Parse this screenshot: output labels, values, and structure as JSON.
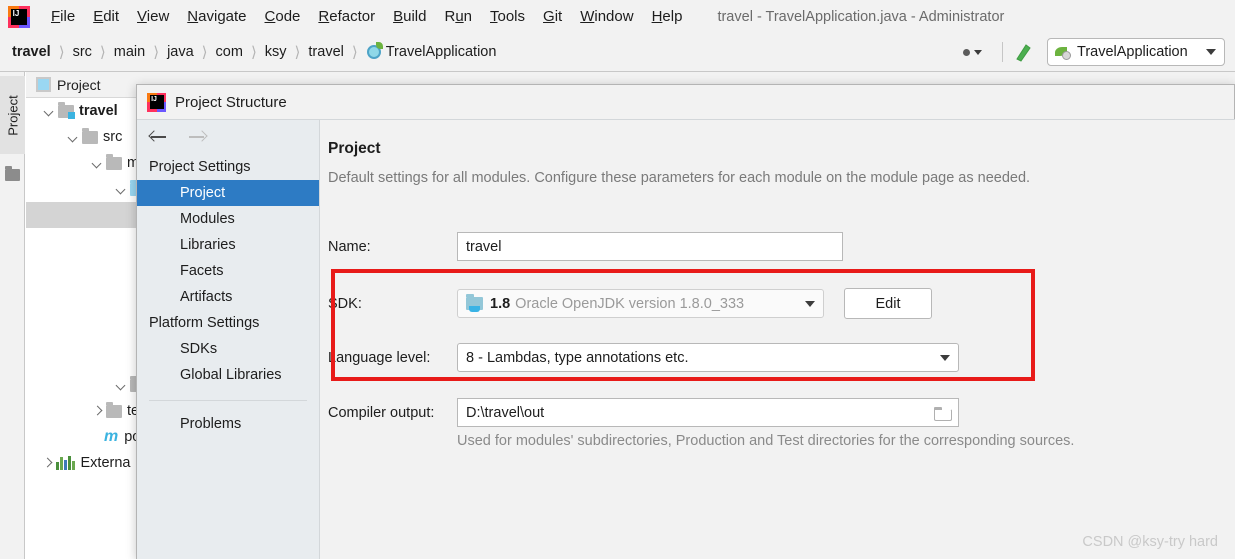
{
  "window": {
    "title": "travel - TravelApplication.java - Administrator",
    "app_icon": "intellij-idea-icon"
  },
  "menubar": {
    "items": [
      {
        "label": "File",
        "mnemonic": "F"
      },
      {
        "label": "Edit",
        "mnemonic": "E"
      },
      {
        "label": "View",
        "mnemonic": "V"
      },
      {
        "label": "Navigate",
        "mnemonic": "N"
      },
      {
        "label": "Code",
        "mnemonic": "C"
      },
      {
        "label": "Refactor",
        "mnemonic": "R"
      },
      {
        "label": "Build",
        "mnemonic": "B"
      },
      {
        "label": "Run",
        "mnemonic": "u"
      },
      {
        "label": "Tools",
        "mnemonic": "T"
      },
      {
        "label": "Git",
        "mnemonic": "G"
      },
      {
        "label": "Window",
        "mnemonic": "W"
      },
      {
        "label": "Help",
        "mnemonic": "H"
      }
    ]
  },
  "navbar": {
    "crumbs": [
      "travel",
      "src",
      "main",
      "java",
      "com",
      "ksy",
      "travel"
    ],
    "separator": "〉",
    "file_crumb": "TravelApplication",
    "file_icon": "spring-boot-class-icon",
    "user_icon": "user-avatar-icon",
    "hammer_icon": "build-hammer-icon",
    "run_config": {
      "label": "TravelApplication",
      "icon": "spring-boot-run-config-icon"
    }
  },
  "tool_window": {
    "vertical_tab": "Project",
    "folder_icon": "folder-icon",
    "header": "Project",
    "header_icon": "project-view-icon",
    "tree": [
      {
        "label": "travel",
        "bold": true,
        "indent": 0,
        "chevron": "down",
        "icon": "module-folder-icon"
      },
      {
        "label": "src",
        "bold": false,
        "indent": 1,
        "chevron": "down",
        "icon": "folder-icon"
      },
      {
        "label": "m",
        "bold": false,
        "indent": 2,
        "chevron": "down",
        "icon": "folder-icon"
      },
      {
        "label": "",
        "bold": false,
        "indent": 3,
        "chevron": "down",
        "icon": "source-folder-icon"
      },
      {
        "label": "",
        "bold": false,
        "indent": 4,
        "chevron": "down",
        "icon": "folder-icon",
        "selected": true
      },
      {
        "label": "",
        "bold": false,
        "indent": 3,
        "chevron": "down",
        "icon": "folder-icon"
      },
      {
        "label": "te",
        "bold": false,
        "indent": 2,
        "chevron": "right",
        "icon": "folder-icon"
      },
      {
        "label": "pom",
        "bold": false,
        "indent": 2,
        "chevron": "none",
        "icon": "maven-pom-icon"
      },
      {
        "label": "Externa",
        "bold": false,
        "indent": 0,
        "chevron": "right",
        "icon": "external-libraries-icon"
      }
    ]
  },
  "dialog": {
    "title": "Project Structure",
    "icon": "intellij-idea-icon",
    "nav": {
      "back_icon": "arrow-left-icon",
      "forward_icon": "arrow-right-icon",
      "groups": [
        {
          "label": "Project Settings",
          "items": [
            "Project",
            "Modules",
            "Libraries",
            "Facets",
            "Artifacts"
          ]
        },
        {
          "label": "Platform Settings",
          "items": [
            "SDKs",
            "Global Libraries"
          ]
        }
      ],
      "selected": "Project",
      "footer_item": "Problems"
    },
    "page": {
      "title": "Project",
      "description": "Default settings for all modules. Configure these parameters for each module on the module page as needed.",
      "fields": {
        "name": {
          "label": "Name:",
          "value": "travel"
        },
        "sdk": {
          "label": "SDK:",
          "version": "1.8",
          "detail": "Oracle OpenJDK version 1.8.0_333",
          "icon": "jdk-folder-icon",
          "caret_icon": "chevron-down-icon",
          "edit_button": "Edit",
          "disabled": true
        },
        "language_level": {
          "label": "Language level:",
          "value": "8 - Lambdas, type annotations etc.",
          "caret_icon": "chevron-down-icon"
        },
        "compiler_output": {
          "label": "Compiler output:",
          "value": "D:\\travel\\out",
          "browse_icon": "folder-browse-icon",
          "hint": "Used for modules' subdirectories, Production and Test directories for the corresponding sources."
        }
      }
    }
  },
  "annotation": {
    "color": "#e81b19",
    "shape": "rectangle-highlight"
  },
  "watermark": "CSDN @ksy-try hard"
}
